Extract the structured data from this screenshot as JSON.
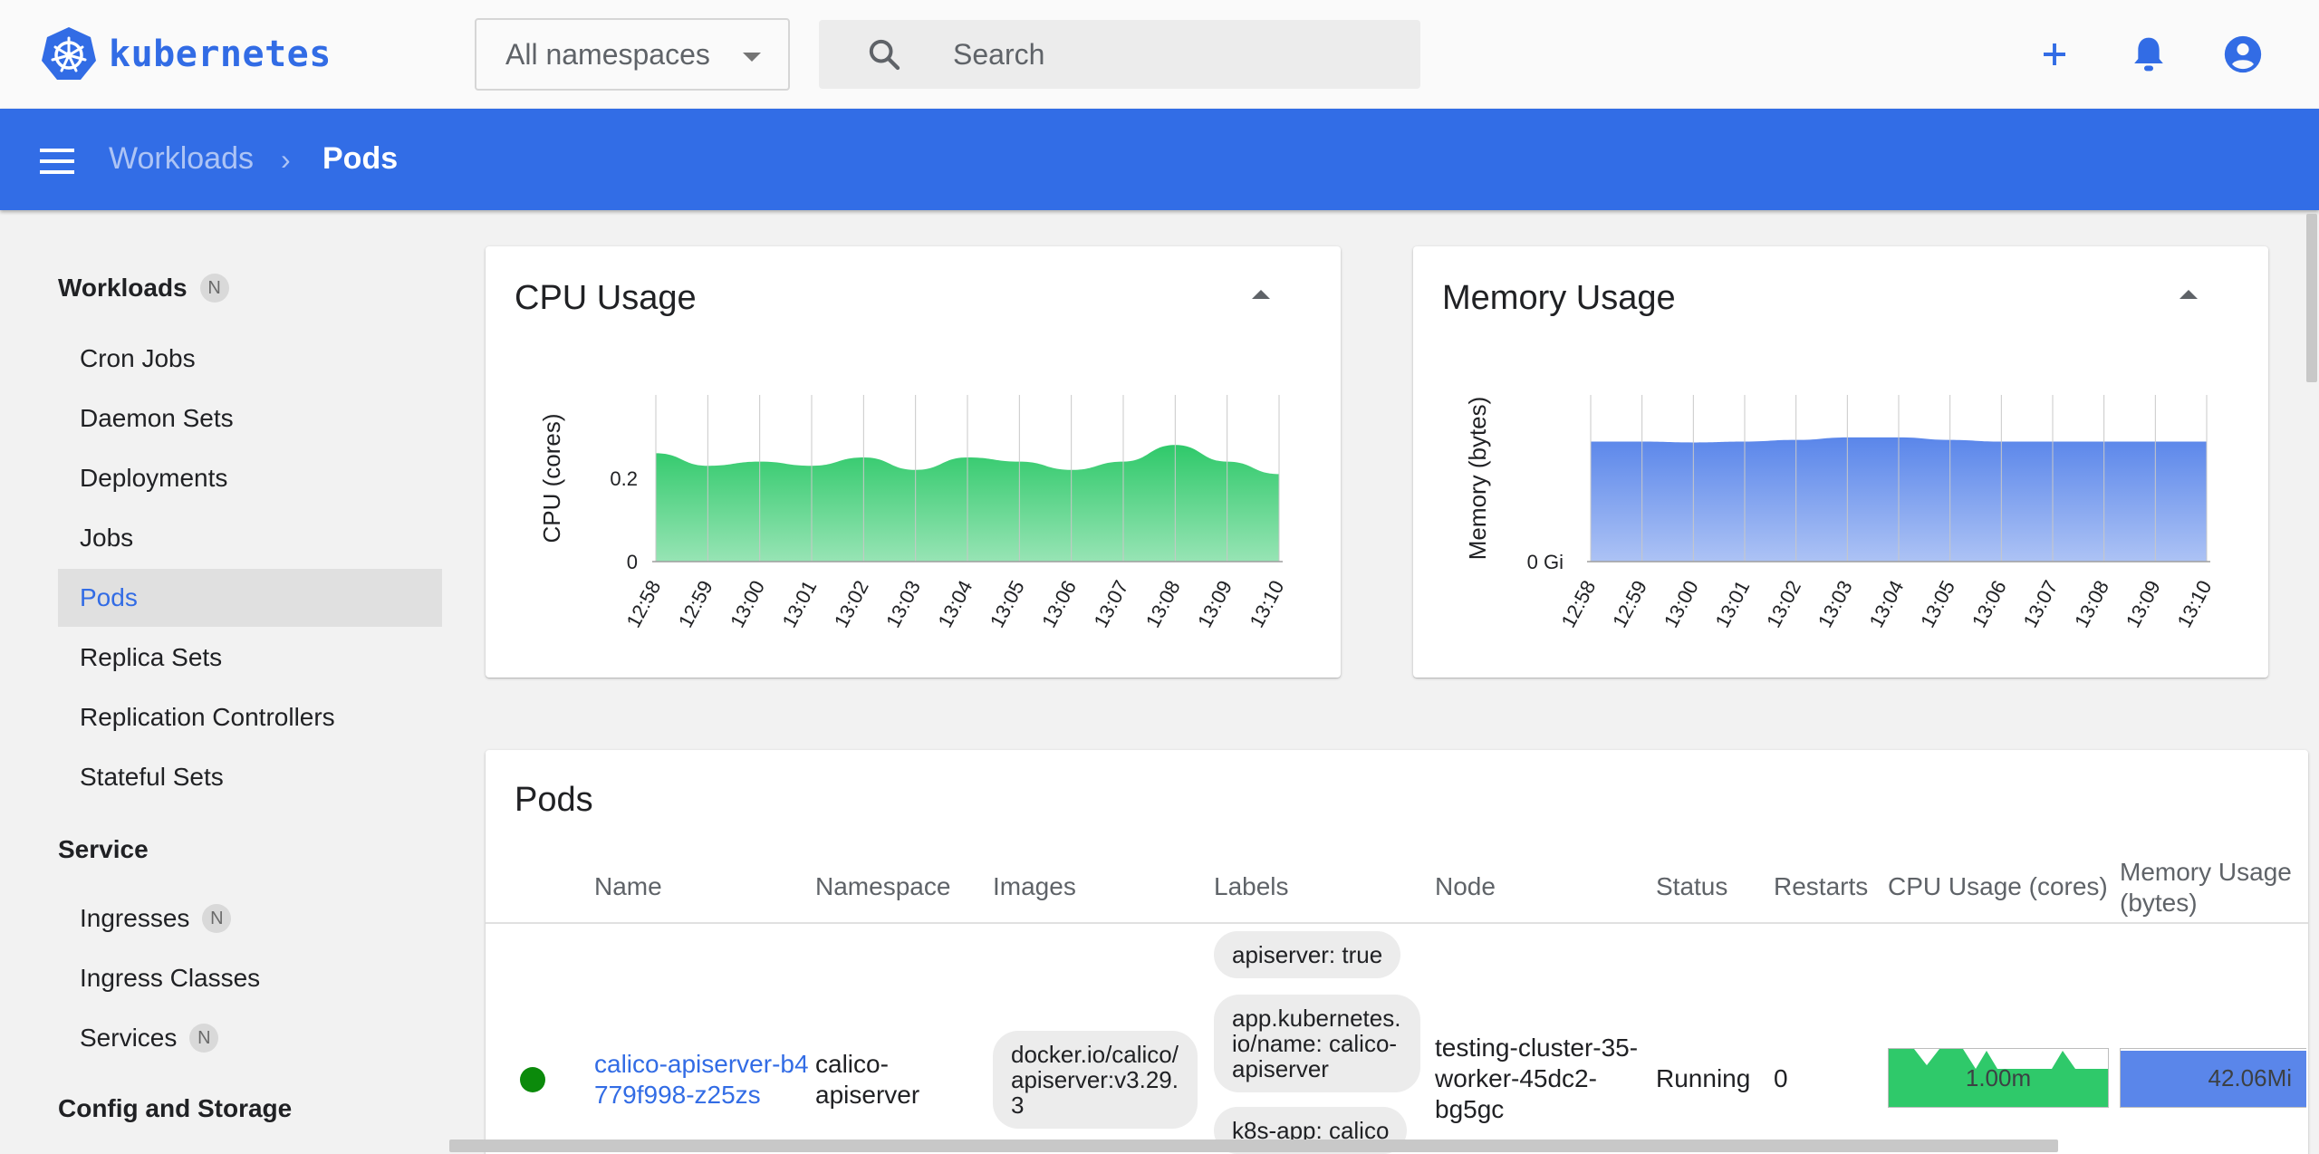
{
  "app": {
    "logo_text": "kubernetes",
    "namespace_select": "All namespaces",
    "search_placeholder": "Search",
    "accent_color": "#326ce5"
  },
  "header": {
    "breadcrumb": [
      "Workloads",
      "Pods"
    ]
  },
  "sidebar": {
    "sections": [
      {
        "title": "Workloads",
        "badge": "N",
        "items": [
          "Cron Jobs",
          "Daemon Sets",
          "Deployments",
          "Jobs",
          "Pods",
          "Replica Sets",
          "Replication Controllers",
          "Stateful Sets"
        ]
      },
      {
        "title": "Service",
        "items": [
          {
            "label": "Ingresses",
            "badge": "N"
          },
          {
            "label": "Ingress Classes"
          },
          {
            "label": "Services",
            "badge": "N"
          }
        ]
      },
      {
        "title": "Config and Storage"
      }
    ],
    "active_item": "Pods"
  },
  "chart_data": [
    {
      "type": "area",
      "title": "CPU Usage",
      "ylabel": "CPU (cores)",
      "y_ticks": [
        "0",
        "0.2"
      ],
      "ylim": [
        0,
        0.4
      ],
      "x": [
        "12:58",
        "12:59",
        "13:00",
        "13:01",
        "13:02",
        "13:03",
        "13:04",
        "13:05",
        "13:06",
        "13:07",
        "13:08",
        "13:09",
        "13:10"
      ],
      "values": [
        0.26,
        0.23,
        0.24,
        0.23,
        0.25,
        0.22,
        0.25,
        0.24,
        0.22,
        0.24,
        0.28,
        0.24,
        0.21
      ],
      "color": "#2fc96a",
      "grid": true
    },
    {
      "type": "area",
      "title": "Memory Usage",
      "ylabel": "Memory (bytes)",
      "y_ticks": [
        "0 Gi"
      ],
      "ylim": [
        0,
        1
      ],
      "x": [
        "12:58",
        "12:59",
        "13:00",
        "13:01",
        "13:02",
        "13:03",
        "13:04",
        "13:05",
        "13:06",
        "13:07",
        "13:08",
        "13:09",
        "13:10"
      ],
      "values": [
        0.72,
        0.72,
        0.715,
        0.72,
        0.73,
        0.745,
        0.745,
        0.73,
        0.72,
        0.72,
        0.72,
        0.72,
        0.72
      ],
      "color": "#5a86ea",
      "grid": true
    }
  ],
  "pods": {
    "title": "Pods",
    "columns": [
      "Name",
      "Namespace",
      "Images",
      "Labels",
      "Node",
      "Status",
      "Restarts",
      "CPU Usage (cores)",
      "Memory Usage (bytes)"
    ],
    "rows": [
      {
        "status_color": "#0b8a0b",
        "name": "calico-apiserver-b4779f998-z25zs",
        "namespace": "calico-apiserver",
        "image": "docker.io/calico/apiserver:v3.29.3",
        "labels": [
          "apiserver: true",
          "app.kubernetes.io/name: calico-apiserver",
          "k8s-app: calico"
        ],
        "node": "testing-cluster-35-worker-45dc2-bg5gc",
        "status": "Running",
        "restarts": "0",
        "cpu_usage": "1.00m",
        "memory_usage": "42.06Mi"
      }
    ]
  }
}
